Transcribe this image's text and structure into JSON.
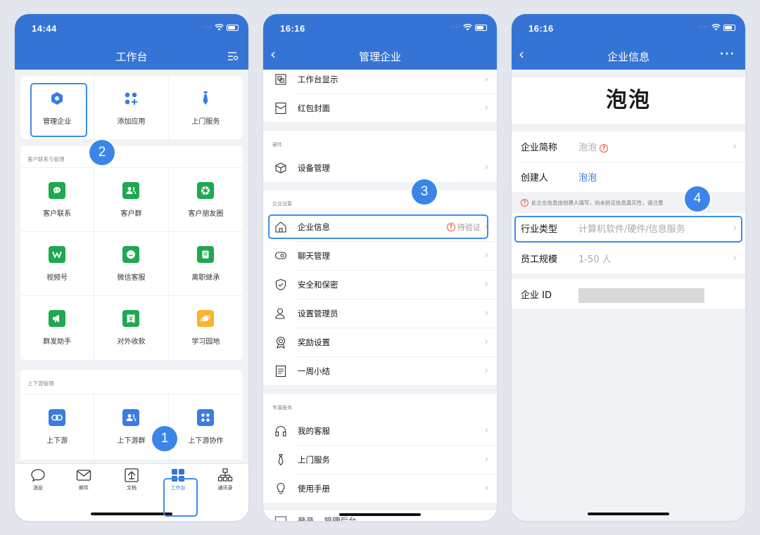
{
  "colors": {
    "brand": "#3574d5",
    "green": "#1fa851",
    "blue": "#3a7ce0",
    "alert": "#f0543b",
    "highlight": "#3f8cec"
  },
  "phone1": {
    "time": "14:44",
    "title": "工作台",
    "top_apps": [
      {
        "label": "管理企业",
        "icon": "hexagon-icon"
      },
      {
        "label": "添加应用",
        "icon": "add-apps-icon"
      },
      {
        "label": "上门服务",
        "icon": "tie-icon"
      }
    ],
    "customer_section": {
      "title": "客户联系与管理",
      "apps": [
        {
          "label": "客户联系",
          "icon": "chat-bubble-icon"
        },
        {
          "label": "客户群",
          "icon": "group-icon"
        },
        {
          "label": "客户朋友圈",
          "icon": "moments-icon"
        },
        {
          "label": "视频号",
          "icon": "channels-icon"
        },
        {
          "label": "微信客服",
          "icon": "service-chat-icon"
        },
        {
          "label": "离职继承",
          "icon": "document-icon"
        },
        {
          "label": "群发助手",
          "icon": "megaphone-icon"
        },
        {
          "label": "对外收款",
          "icon": "yuan-icon"
        },
        {
          "label": "学习园地",
          "icon": "planet-icon"
        }
      ]
    },
    "chain_section": {
      "title": "上下游管理",
      "apps": [
        {
          "label": "上下游",
          "icon": "link-icon"
        },
        {
          "label": "上下游群",
          "icon": "group-icon"
        },
        {
          "label": "上下游协作",
          "icon": "grid-icon"
        }
      ]
    },
    "tabs": [
      {
        "label": "消息",
        "icon": "message-icon"
      },
      {
        "label": "邮件",
        "icon": "mail-icon"
      },
      {
        "label": "文档",
        "icon": "doc-icon"
      },
      {
        "label": "工作台",
        "icon": "workbench-icon"
      },
      {
        "label": "通讯录",
        "icon": "contacts-icon"
      }
    ]
  },
  "phone2": {
    "time": "16:16",
    "title": "管理企业",
    "top_items": [
      {
        "label": "工作台显示",
        "icon": "display-icon"
      },
      {
        "label": "红包封面",
        "icon": "red-envelope-icon"
      }
    ],
    "hardware": {
      "title": "硬件",
      "items": [
        {
          "label": "设备管理",
          "icon": "box-icon"
        }
      ]
    },
    "settings": {
      "title": "企业设置",
      "items": [
        {
          "label": "企业信息",
          "icon": "home-icon",
          "status": "待验证"
        },
        {
          "label": "聊天管理",
          "icon": "chat-icon"
        },
        {
          "label": "安全和保密",
          "icon": "shield-icon"
        },
        {
          "label": "设置管理员",
          "icon": "admin-icon"
        },
        {
          "label": "奖励设置",
          "icon": "award-icon"
        },
        {
          "label": "一周小结",
          "icon": "report-icon"
        }
      ]
    },
    "exclusive": {
      "title": "专属服务",
      "items": [
        {
          "label": "我的客服",
          "icon": "headset-icon"
        },
        {
          "label": "上门服务",
          "icon": "tie-icon"
        },
        {
          "label": "使用手册",
          "icon": "bulb-icon"
        }
      ]
    },
    "last_item": "登录... 管理后台"
  },
  "phone3": {
    "time": "16:16",
    "title": "企业信息",
    "company_name": "泡泡",
    "rows": [
      {
        "key": "企业简称",
        "value": "泡泡"
      },
      {
        "key": "创建人",
        "value": "泡泡"
      }
    ],
    "note": "此企业信息由创建人填写，尚未验证信息真实性，请注意",
    "rows2": [
      {
        "key": "行业类型",
        "value": "计算机软件/硬件/信息服务"
      },
      {
        "key": "员工规模",
        "value": "1-50 人"
      }
    ],
    "id_key": "企业 ID"
  },
  "steps": {
    "s1": "1",
    "s2": "2",
    "s3": "3",
    "s4": "4"
  }
}
